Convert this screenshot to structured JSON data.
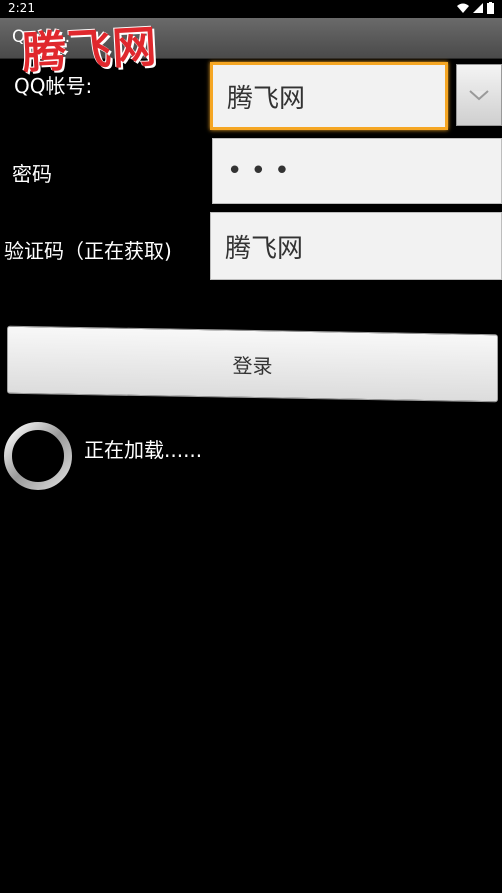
{
  "status_bar": {
    "time": "2:21",
    "icons": [
      "wifi-icon",
      "signal-icon",
      "battery-icon"
    ]
  },
  "title_bar": {
    "title": "Q  …  …"
  },
  "watermark": {
    "text": "腾飞网",
    "color": "#e0282d"
  },
  "form": {
    "qq_label": "QQ帐号:",
    "qq_value": "腾飞网",
    "password_label": "密码",
    "password_value": "• • •",
    "captcha_label": "验证码（正在获取)",
    "captcha_value": "腾飞网",
    "login_button": "登录"
  },
  "loading": {
    "text": "正在加载......"
  },
  "colors": {
    "focus": "#f5a623",
    "background": "#000000"
  }
}
